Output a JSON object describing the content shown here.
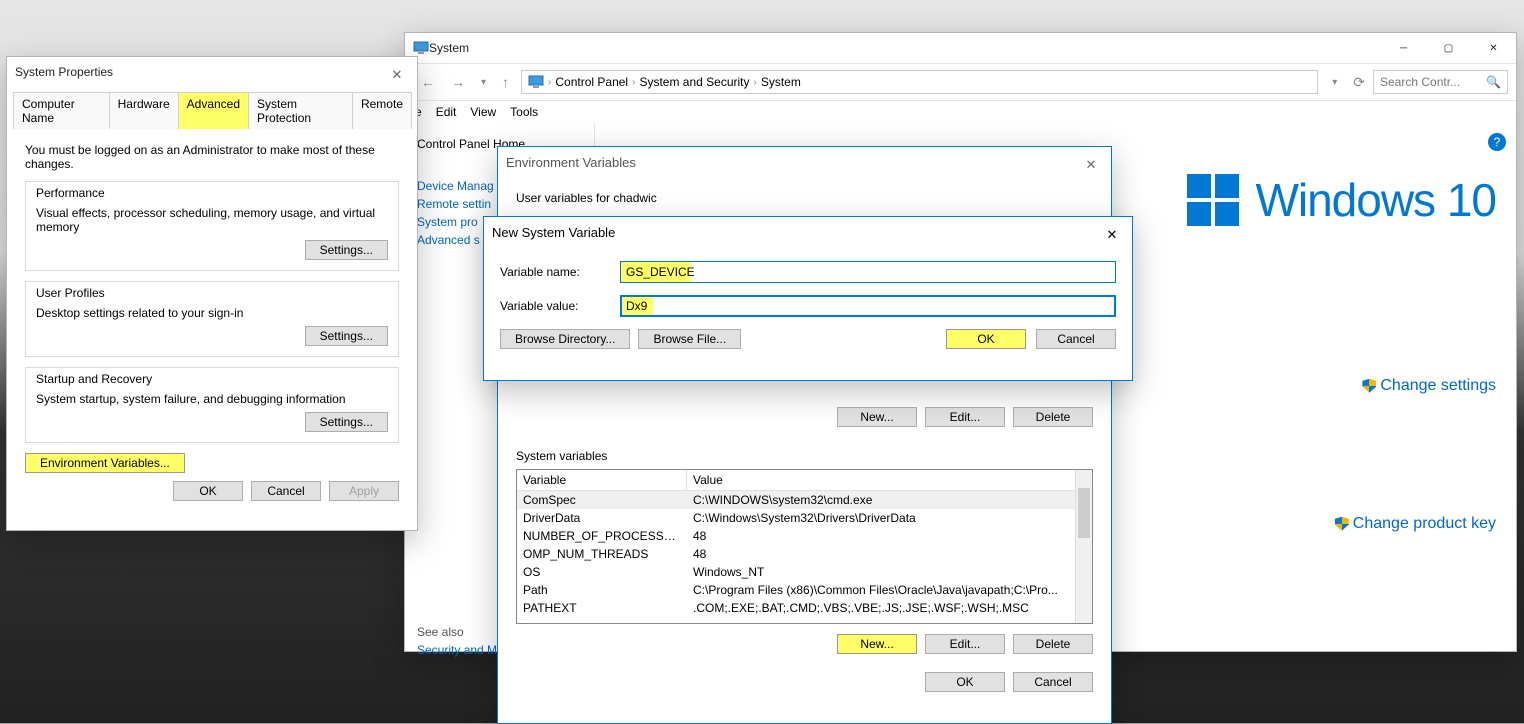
{
  "system_properties": {
    "title": "System Properties",
    "tabs": [
      "Computer Name",
      "Hardware",
      "Advanced",
      "System Protection",
      "Remote"
    ],
    "active_tab": "Advanced",
    "admin_note": "You must be logged on as an Administrator to make most of these changes.",
    "perf": {
      "title": "Performance",
      "desc": "Visual effects, processor scheduling, memory usage, and virtual memory",
      "btn": "Settings..."
    },
    "profiles": {
      "title": "User Profiles",
      "desc": "Desktop settings related to your sign-in",
      "btn": "Settings..."
    },
    "startup": {
      "title": "Startup and Recovery",
      "desc": "System startup, system failure, and debugging information",
      "btn": "Settings..."
    },
    "envvar_btn": "Environment Variables...",
    "footer": {
      "ok": "OK",
      "cancel": "Cancel",
      "apply": "Apply"
    }
  },
  "system_window": {
    "title": "System",
    "breadcrumb": [
      "Control Panel",
      "System and Security",
      "System"
    ],
    "search_placeholder": "Search Contr...",
    "menus": [
      "e",
      "Edit",
      "View",
      "Tools"
    ],
    "side": {
      "home": "Control Panel Home",
      "items": [
        "Device Manag",
        "Remote settin",
        "System pro",
        "Advanced s"
      ],
      "see_also": "See also",
      "sec": "Security and M"
    },
    "links": {
      "change_settings": "Change settings",
      "product_key": "Change product key"
    },
    "logo_text": "Windows 10"
  },
  "env_vars": {
    "title": "Environment Variables",
    "user_section": "User variables for chadwic",
    "sys_section": "System variables",
    "cols": [
      "Variable",
      "Value"
    ],
    "sys_rows": [
      [
        "ComSpec",
        "C:\\WINDOWS\\system32\\cmd.exe"
      ],
      [
        "DriverData",
        "C:\\Windows\\System32\\Drivers\\DriverData"
      ],
      [
        "NUMBER_OF_PROCESSORS",
        "48"
      ],
      [
        "OMP_NUM_THREADS",
        "48"
      ],
      [
        "OS",
        "Windows_NT"
      ],
      [
        "Path",
        "C:\\Program Files (x86)\\Common Files\\Oracle\\Java\\javapath;C:\\Pro..."
      ],
      [
        "PATHEXT",
        ".COM;.EXE;.BAT;.CMD;.VBS;.VBE;.JS;.JSE;.WSF;.WSH;.MSC"
      ]
    ],
    "btns": {
      "new": "New...",
      "edit": "Edit...",
      "delete": "Delete"
    },
    "footer": {
      "ok": "OK",
      "cancel": "Cancel"
    }
  },
  "new_var": {
    "title": "New System Variable",
    "name_label": "Variable name:",
    "name_value": "GS_DEVICE",
    "value_label": "Variable value:",
    "value_value": "Dx9",
    "browse_dir": "Browse Directory...",
    "browse_file": "Browse File...",
    "ok": "OK",
    "cancel": "Cancel"
  }
}
